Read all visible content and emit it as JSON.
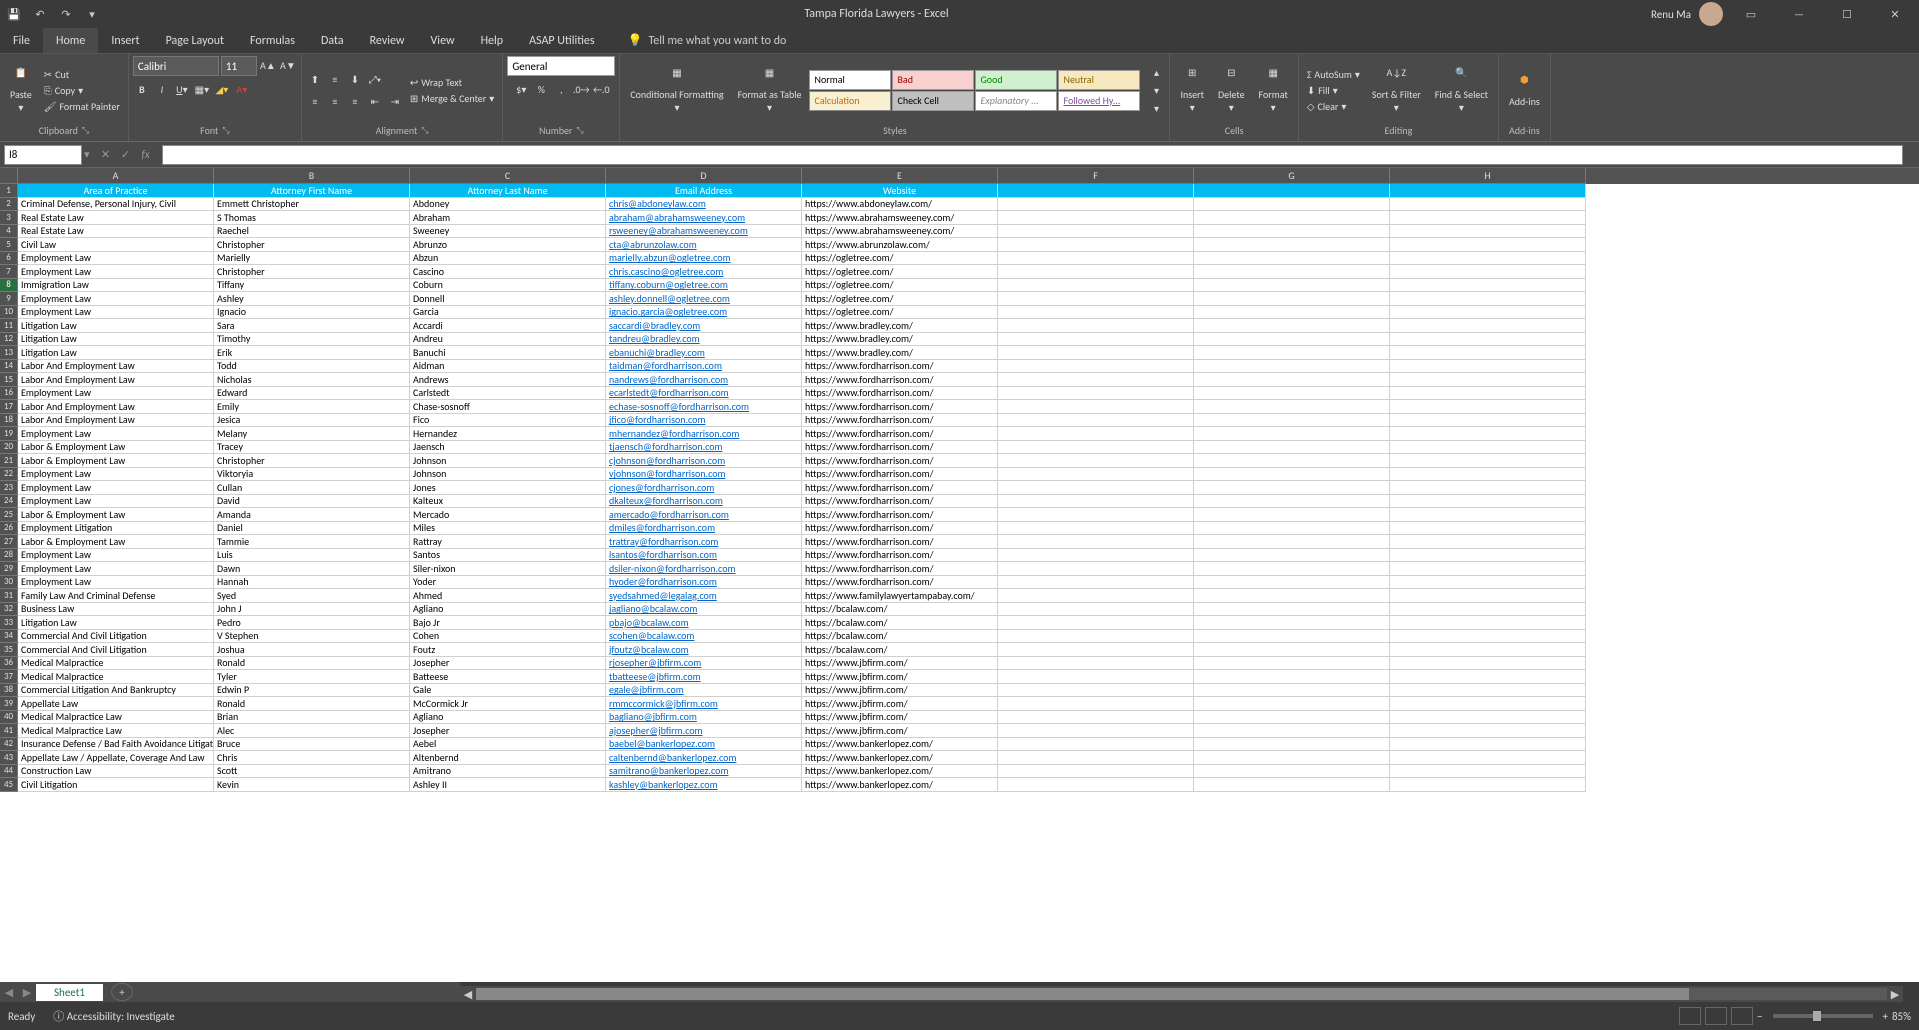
{
  "title": "Tampa Florida Lawyers - Excel",
  "user": "Renu Ma",
  "tabs": [
    "File",
    "Home",
    "Insert",
    "Page Layout",
    "Formulas",
    "Data",
    "Review",
    "View",
    "Help",
    "ASAP Utilities"
  ],
  "active_tab": "Home",
  "tell_me": "Tell me what you want to do",
  "clipboard": {
    "label": "Clipboard",
    "paste": "Paste",
    "cut": "Cut",
    "copy": "Copy",
    "fp": "Format Painter"
  },
  "font": {
    "label": "Font",
    "name": "Calibri",
    "size": "11"
  },
  "alignment": {
    "label": "Alignment",
    "wrap": "Wrap Text",
    "merge": "Merge & Center"
  },
  "number": {
    "label": "Number",
    "format": "General"
  },
  "styles": {
    "label": "Styles",
    "cf": "Conditional Formatting",
    "fat": "Format as Table",
    "items": [
      "Normal",
      "Bad",
      "Good",
      "Neutral",
      "Calculation",
      "Check Cell",
      "Explanatory ...",
      "Followed Hy..."
    ]
  },
  "cells": {
    "label": "Cells",
    "insert": "Insert",
    "delete": "Delete",
    "format": "Format"
  },
  "editing": {
    "label": "Editing",
    "autosum": "AutoSum",
    "fill": "Fill",
    "clear": "Clear",
    "sort": "Sort & Filter",
    "find": "Find & Select"
  },
  "addins": {
    "label": "Add-ins",
    "btn": "Add-ins"
  },
  "name_box": "I8",
  "columns": [
    "A",
    "B",
    "C",
    "D",
    "E",
    "F",
    "G",
    "H"
  ],
  "headers": [
    "Area of Practice",
    "Attorney First Name",
    "Attorney Last Name",
    "Email Address",
    "Website"
  ],
  "rows": [
    [
      "Criminal Defense, Personal Injury, Civil",
      "Emmett Christopher",
      "Abdoney",
      "chris@abdoneylaw.com",
      "https://www.abdoneylaw.com/"
    ],
    [
      "Real Estate Law",
      "S Thomas",
      "Abraham",
      "abraham@abrahamsweeney.com",
      "https://www.abrahamsweeney.com/"
    ],
    [
      "Real Estate Law",
      "Raechel",
      "Sweeney",
      "rsweeney@abrahamsweeney.com",
      "https://www.abrahamsweeney.com/"
    ],
    [
      "Civil Law",
      "Christopher",
      "Abrunzo",
      "cta@abrunzolaw.com",
      "https://www.abrunzolaw.com/"
    ],
    [
      "Employment Law",
      "Marielly",
      "Abzun",
      "marielly.abzun@ogletree.com",
      "https://ogletree.com/"
    ],
    [
      "Employment Law",
      "Christopher",
      "Cascino",
      "chris.cascino@ogletree.com",
      "https://ogletree.com/"
    ],
    [
      "Immigration Law",
      "Tiffany",
      "Coburn",
      "tiffany.coburn@ogletree.com",
      "https://ogletree.com/"
    ],
    [
      "Employment Law",
      "Ashley",
      "Donnell",
      "ashley.donnell@ogletree.com",
      "https://ogletree.com/"
    ],
    [
      "Employment Law",
      "Ignacio",
      "Garcia",
      "ignacio.garcia@ogletree.com",
      "https://ogletree.com/"
    ],
    [
      "Litigation Law",
      "Sara",
      "Accardi",
      "saccardi@bradley.com",
      "https://www.bradley.com/"
    ],
    [
      "Litigation Law",
      "Timothy",
      "Andreu",
      "tandreu@bradley.com",
      "https://www.bradley.com/"
    ],
    [
      "Litigation Law",
      "Erik",
      "Banuchi",
      "ebanuchi@bradley.com",
      "https://www.bradley.com/"
    ],
    [
      "Labor And Employment Law",
      "Todd",
      "Aidman",
      "taidman@fordharrison.com",
      "https://www.fordharrison.com/"
    ],
    [
      "Labor And Employment Law",
      "Nicholas",
      "Andrews",
      "nandrews@fordharrison.com",
      "https://www.fordharrison.com/"
    ],
    [
      "Employment Law",
      "Edward",
      "Carlstedt",
      "ecarlstedt@fordharrison.com",
      "https://www.fordharrison.com/"
    ],
    [
      "Labor And Employment Law",
      "Emily",
      "Chase-sosnoff",
      "echase-sosnoff@fordharrison.com",
      "https://www.fordharrison.com/"
    ],
    [
      "Labor And Employment Law",
      "Jesica",
      "Fico",
      "jfico@fordharrison.com",
      "https://www.fordharrison.com/"
    ],
    [
      "Employment Law",
      "Melany",
      "Hernandez",
      "mhernandez@fordharrison.com",
      "https://www.fordharrison.com/"
    ],
    [
      "Labor & Employment Law",
      "Tracey",
      "Jaensch",
      "tjaensch@fordharrison.com",
      "https://www.fordharrison.com/"
    ],
    [
      "Labor & Employment Law",
      "Christopher",
      "Johnson",
      "cjohnson@fordharrison.com",
      "https://www.fordharrison.com/"
    ],
    [
      "Employment Law",
      "Viktoryia",
      "Johnson",
      "vjohnson@fordharrison.com",
      "https://www.fordharrison.com/"
    ],
    [
      "Employment Law",
      "Cullan",
      "Jones",
      "cjones@fordharrison.com",
      "https://www.fordharrison.com/"
    ],
    [
      "Employment Law",
      "David",
      "Kalteux",
      "dkalteux@fordharrison.com",
      "https://www.fordharrison.com/"
    ],
    [
      "Labor & Employment Law",
      "Amanda",
      "Mercado",
      "amercado@fordharrison.com",
      "https://www.fordharrison.com/"
    ],
    [
      "Employment Litigation",
      "Daniel",
      "Miles",
      "dmiles@fordharrison.com",
      "https://www.fordharrison.com/"
    ],
    [
      "Labor & Employment Law",
      "Tammie",
      "Rattray",
      "trattray@fordharrison.com",
      "https://www.fordharrison.com/"
    ],
    [
      "Employment Law",
      "Luis",
      "Santos",
      "lsantos@fordharrison.com",
      "https://www.fordharrison.com/"
    ],
    [
      "Employment Law",
      "Dawn",
      "Siler-nixon",
      "dsiler-nixon@fordharrison.com",
      "https://www.fordharrison.com/"
    ],
    [
      "Employment Law",
      "Hannah",
      "Yoder",
      "hyoder@fordharrison.com",
      "https://www.fordharrison.com/"
    ],
    [
      "Family Law And Criminal Defense",
      "Syed",
      "Ahmed",
      "syedsahmed@legalag.com",
      "https://www.familylawyertampabay.com/"
    ],
    [
      "Business Law",
      "John J",
      "Agliano",
      "jagliano@bcalaw.com",
      "https://bcalaw.com/"
    ],
    [
      "Litigation Law",
      "Pedro",
      "Bajo Jr",
      "pbajo@bcalaw.com",
      "https://bcalaw.com/"
    ],
    [
      "Commercial And Civil Litigation",
      "V Stephen",
      "Cohen",
      "scohen@bcalaw.com",
      "https://bcalaw.com/"
    ],
    [
      "Commercial And Civil Litigation",
      "Joshua",
      "Foutz",
      "jfoutz@bcalaw.com",
      "https://bcalaw.com/"
    ],
    [
      "Medical Malpractice",
      "Ronald",
      "Josepher",
      "rjosepher@jbfirm.com",
      "https://www.jbfirm.com/"
    ],
    [
      "Medical Malpractice",
      "Tyler",
      "Batteese",
      "tbatteese@jbfirm.com",
      "https://www.jbfirm.com/"
    ],
    [
      "Commercial Litigation And Bankruptcy",
      "Edwin P",
      "Gale",
      "egale@jbfirm.com",
      "https://www.jbfirm.com/"
    ],
    [
      "Appellate Law",
      "Ronald",
      "McCormick Jr",
      "rmmccormick@jbfirm.com",
      "https://www.jbfirm.com/"
    ],
    [
      "Medical Malpractice Law",
      "Brian",
      "Agliano",
      "bagliano@jbfirm.com",
      "https://www.jbfirm.com/"
    ],
    [
      "Medical Malpractice Law",
      "Alec",
      "Josepher",
      "ajosepher@jbfirm.com",
      "https://www.jbfirm.com/"
    ],
    [
      "Insurance Defense / Bad Faith Avoidance Litigation",
      "Bruce",
      "Aebel",
      "baebel@bankerlopez.com",
      "https://www.bankerlopez.com/"
    ],
    [
      "Appellate Law / Appellate, Coverage And Law",
      "Chris",
      "Altenbernd",
      "caltenbernd@bankerlopez.com",
      "https://www.bankerlopez.com/"
    ],
    [
      "Construction Law",
      "Scott",
      "Amitrano",
      "samitrano@bankerlopez.com",
      "https://www.bankerlopez.com/"
    ],
    [
      "Civil Litigation",
      "Kevin",
      "Ashley II",
      "kashley@bankerlopez.com",
      "https://www.bankerlopez.com/"
    ]
  ],
  "sheet": "Sheet1",
  "status": {
    "ready": "Ready",
    "acc": "Accessibility: Investigate",
    "zoom": "85%"
  }
}
